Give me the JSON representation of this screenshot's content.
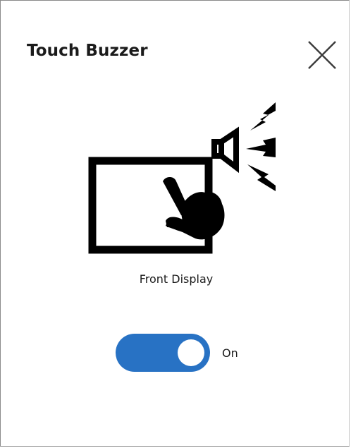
{
  "dialog": {
    "title": "Touch Buzzer",
    "close_icon": "close-icon"
  },
  "illustration": {
    "icon": "touch-screen-buzzer-icon",
    "label": "Front Display"
  },
  "toggle": {
    "state": true,
    "label": "On",
    "accent_color": "#2872c4"
  }
}
